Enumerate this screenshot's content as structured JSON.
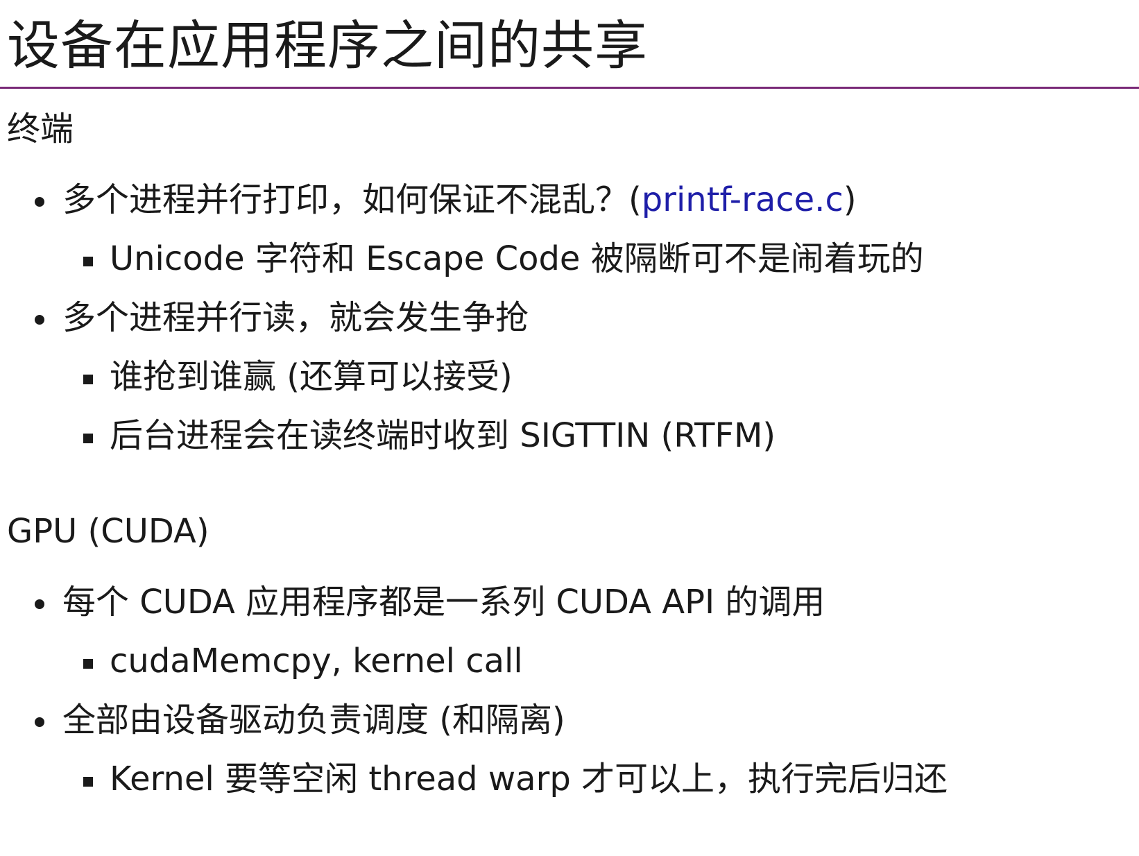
{
  "title": "设备在应用程序之间的共享",
  "sections": [
    {
      "heading": "终端",
      "items": [
        {
          "text": "多个进程并行打印，如何保证不混乱？(",
          "link": "printf-race.c",
          "suffix": ")"
        },
        {
          "text": "Unicode 字符和 Escape Code 被隔断可不是闹着玩的"
        },
        {
          "text": "多个进程并行读，就会发生争抢"
        },
        {
          "text": "谁抢到谁赢 (还算可以接受)"
        },
        {
          "text": "后台进程会在读终端时收到 SIGTTIN (RTFM)"
        }
      ]
    },
    {
      "heading": "GPU (CUDA)",
      "items": [
        {
          "text": "每个 CUDA 应用程序都是一系列 CUDA API 的调用"
        },
        {
          "text": "cudaMemcpy, kernel call"
        },
        {
          "text": "全部由设备驱动负责调度 (和隔离)"
        },
        {
          "text": "Kernel 要等空闲 thread warp 才可以上，执行完后归还"
        }
      ]
    }
  ],
  "colors": {
    "title_rule": "#7a2a78",
    "link": "#1e1ea8",
    "text": "#1a1a1a"
  }
}
